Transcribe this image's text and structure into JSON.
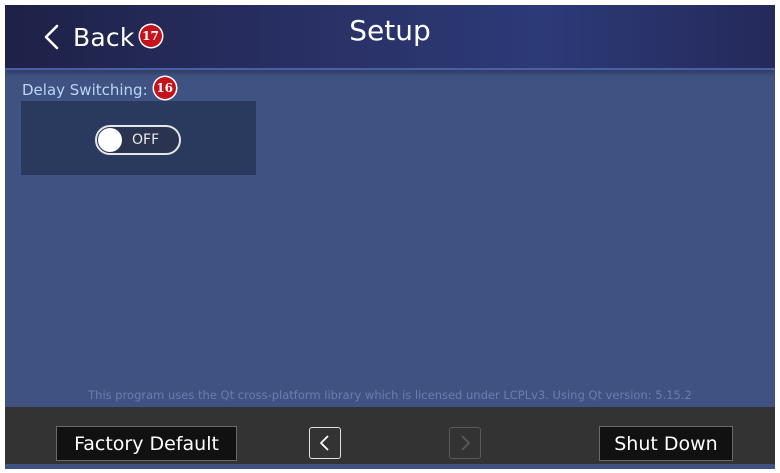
{
  "header": {
    "back_label": "Back",
    "back_badge": "17",
    "title": "Setup"
  },
  "settings": {
    "delay_switching_label": "Delay Switching:",
    "delay_switching_badge": "16",
    "delay_switching_state": "OFF"
  },
  "footer": {
    "license_text": "This program uses the Qt cross-platform library which is licensed under LCPLv3. Using Qt version: 5.15.2",
    "factory_default_label": "Factory Default",
    "shut_down_label": "Shut Down",
    "prev_icon": "chevron-left-icon",
    "next_icon": "chevron-right-icon"
  },
  "colors": {
    "background": "#3f5282",
    "header": "#2a3268",
    "badge": "#c6121b",
    "footer_bar": "#333333",
    "label": "#b9d6f7"
  }
}
